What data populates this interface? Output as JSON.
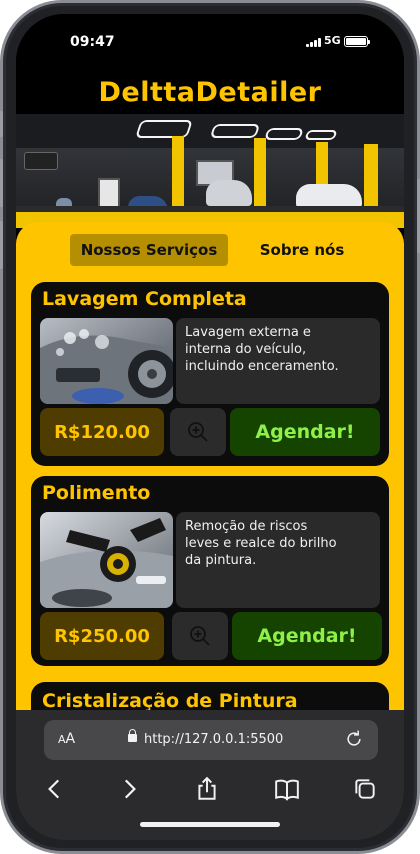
{
  "status": {
    "time": "09:47",
    "network": "5G"
  },
  "brand": {
    "title": "DelttaDetailer"
  },
  "tabs": [
    {
      "label": "Nossos Serviços",
      "active": true
    },
    {
      "label": "Sobre nós",
      "active": false
    }
  ],
  "services": [
    {
      "title": "Lavagem Completa",
      "desc_lines": [
        "Lavagem externa e",
        "interna do veículo,",
        "incluindo enceramento."
      ],
      "price": "R$120.00",
      "book_label": "Agendar!"
    },
    {
      "title": "Polimento",
      "desc_lines": [
        "Remoção de riscos",
        "leves e realce do brilho",
        "da pintura."
      ],
      "price": "R$250.00",
      "book_label": "Agendar!"
    },
    {
      "title": "Cristalização de Pintura"
    }
  ],
  "browser": {
    "aa_small": "A",
    "aa_large": "A",
    "url": "http://127.0.0.1:5500"
  },
  "colors": {
    "accent": "#ffc400",
    "card": "#0c0c0c",
    "price_bg": "#4f3c00",
    "book_bg": "#144400",
    "book_text": "#8ff04a"
  },
  "icons": {
    "zoom": "zoom-in-icon",
    "back": "back-chevron-icon",
    "forward": "forward-chevron-icon",
    "share": "share-icon",
    "bookmarks": "book-icon",
    "tabs": "tabs-icon"
  }
}
